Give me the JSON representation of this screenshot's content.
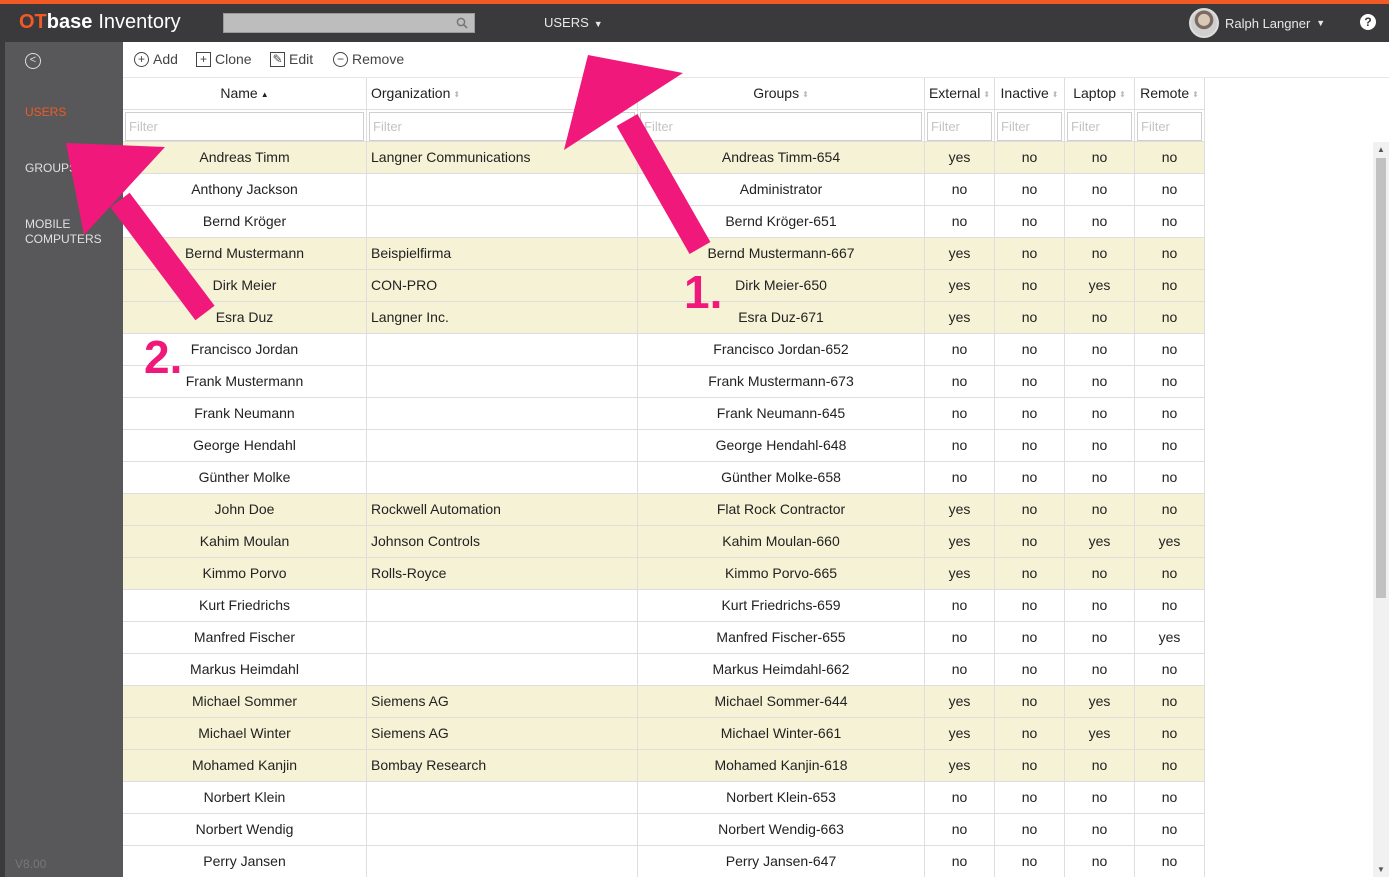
{
  "app": {
    "brand_ot": "OT",
    "brand_base": "base",
    "brand_product": "Inventory",
    "module_label": "USERS",
    "user_name": "Ralph Langner",
    "help_glyph": "?",
    "accent_color": "#f15a24"
  },
  "sidebar": {
    "back_glyph": "<",
    "items": [
      {
        "label": "USERS",
        "active": true
      },
      {
        "label": "GROUPS",
        "active": false
      },
      {
        "label": "MOBILE COMPUTERS",
        "active": false
      }
    ],
    "version": "V8.00"
  },
  "toolbar": {
    "add": "Add",
    "clone": "Clone",
    "edit": "Edit",
    "remove": "Remove"
  },
  "table": {
    "columns": [
      "Name",
      "Organization",
      "Groups",
      "External",
      "Inactive",
      "Laptop",
      "Remote"
    ],
    "sorted_column": "Name",
    "filter_placeholder": "Filter",
    "rows": [
      [
        "Andreas Timm",
        "Langner Communications",
        "Andreas Timm-654",
        "yes",
        "no",
        "no",
        "no"
      ],
      [
        "Anthony Jackson",
        "",
        "Administrator",
        "no",
        "no",
        "no",
        "no"
      ],
      [
        "Bernd Kröger",
        "",
        "Bernd Kröger-651",
        "no",
        "no",
        "no",
        "no"
      ],
      [
        "Bernd Mustermann",
        "Beispielfirma",
        "Bernd Mustermann-667",
        "yes",
        "no",
        "no",
        "no"
      ],
      [
        "Dirk Meier",
        "CON-PRO",
        "Dirk Meier-650",
        "yes",
        "no",
        "yes",
        "no"
      ],
      [
        "Esra Duz",
        "Langner Inc.",
        "Esra Duz-671",
        "yes",
        "no",
        "no",
        "no"
      ],
      [
        "Francisco Jordan",
        "",
        "Francisco Jordan-652",
        "no",
        "no",
        "no",
        "no"
      ],
      [
        "Frank Mustermann",
        "",
        "Frank Mustermann-673",
        "no",
        "no",
        "no",
        "no"
      ],
      [
        "Frank Neumann",
        "",
        "Frank Neumann-645",
        "no",
        "no",
        "no",
        "no"
      ],
      [
        "George Hendahl",
        "",
        "George Hendahl-648",
        "no",
        "no",
        "no",
        "no"
      ],
      [
        "Günther Molke",
        "",
        "Günther Molke-658",
        "no",
        "no",
        "no",
        "no"
      ],
      [
        "John Doe",
        "Rockwell Automation",
        "Flat Rock Contractor",
        "yes",
        "no",
        "no",
        "no"
      ],
      [
        "Kahim Moulan",
        "Johnson Controls",
        "Kahim Moulan-660",
        "yes",
        "no",
        "yes",
        "yes"
      ],
      [
        "Kimmo Porvo",
        "Rolls-Royce",
        "Kimmo Porvo-665",
        "yes",
        "no",
        "no",
        "no"
      ],
      [
        "Kurt Friedrichs",
        "",
        "Kurt Friedrichs-659",
        "no",
        "no",
        "no",
        "no"
      ],
      [
        "Manfred Fischer",
        "",
        "Manfred Fischer-655",
        "no",
        "no",
        "no",
        "yes"
      ],
      [
        "Markus Heimdahl",
        "",
        "Markus Heimdahl-662",
        "no",
        "no",
        "no",
        "no"
      ],
      [
        "Michael Sommer",
        "Siemens AG",
        "Michael Sommer-644",
        "yes",
        "no",
        "yes",
        "no"
      ],
      [
        "Michael Winter",
        "Siemens AG",
        "Michael Winter-661",
        "yes",
        "no",
        "yes",
        "no"
      ],
      [
        "Mohamed Kanjin",
        "Bombay Research",
        "Mohamed Kanjin-618",
        "yes",
        "no",
        "no",
        "no"
      ],
      [
        "Norbert Klein",
        "",
        "Norbert Klein-653",
        "no",
        "no",
        "no",
        "no"
      ],
      [
        "Norbert Wendig",
        "",
        "Norbert Wendig-663",
        "no",
        "no",
        "no",
        "no"
      ],
      [
        "Perry Jansen",
        "",
        "Perry Jansen-647",
        "no",
        "no",
        "no",
        "no"
      ]
    ],
    "highlight_color": "#f6f2d6"
  },
  "annotations": {
    "marker_1": "1.",
    "marker_2": "2.",
    "arrow_color": "#f0187a"
  }
}
